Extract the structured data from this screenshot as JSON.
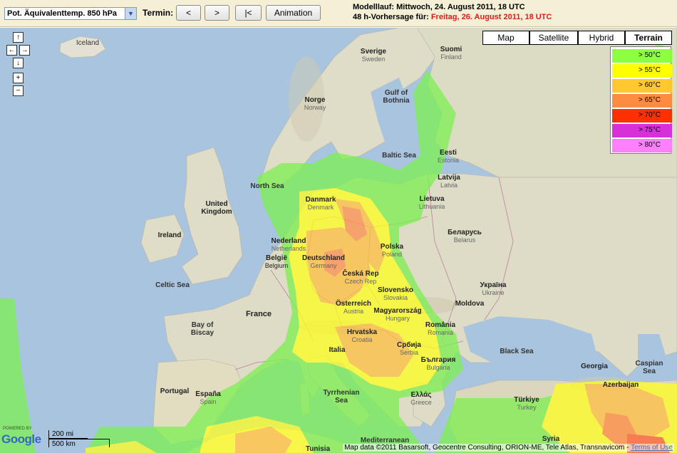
{
  "toolbar": {
    "parameter_selected": "Pot. Äquivalenttemp. 850 hPa",
    "termin_label": "Termin:",
    "btn_prev": "<",
    "btn_next": ">",
    "btn_first": "|<",
    "btn_animation": "Animation",
    "model_run": "Modelllauf: Mittwoch, 24. August 2011, 18 UTC",
    "forecast_prefix": "48 h-Vorhersage für: ",
    "forecast_date": "Freitag, 26. August 2011, 18 UTC"
  },
  "map_types": [
    {
      "label": "Map",
      "active": false
    },
    {
      "label": "Satellite",
      "active": false
    },
    {
      "label": "Hybrid",
      "active": false
    },
    {
      "label": "Terrain",
      "active": true
    }
  ],
  "nav": {
    "up": "↑",
    "left": "←",
    "right": "→",
    "down": "↓",
    "zoom_in": "+",
    "zoom_out": "−"
  },
  "legend": [
    {
      "label": "> 50°C",
      "color": "#8cff40"
    },
    {
      "label": "> 55°C",
      "color": "#ffff00"
    },
    {
      "label": "> 60°C",
      "color": "#ffc830"
    },
    {
      "label": "> 65°C",
      "color": "#ff8c40"
    },
    {
      "label": "> 70°C",
      "color": "#ff3000"
    },
    {
      "label": "> 75°C",
      "color": "#d830d8"
    },
    {
      "label": "> 80°C",
      "color": "#ff80ff"
    }
  ],
  "labels": {
    "iceland": "Iceland",
    "sverige": "Sverige",
    "sweden": "Sweden",
    "suomi": "Suomi",
    "finland": "Finland",
    "norge": "Norge",
    "norway": "Norway",
    "gulf": "Gulf of",
    "bothnia": "Bothnia",
    "eesti": "Eesti",
    "estonia": "Estonia",
    "baltic": "Baltic Sea",
    "latvija": "Latvija",
    "latvia": "Latvia",
    "lietuva": "Lietuva",
    "lithuania": "Lithuania",
    "north_sea": "North Sea",
    "uk1": "United",
    "uk2": "Kingdom",
    "danmark": "Danmark",
    "denmark": "Denmark",
    "belarus_l": "Беларусь",
    "belarus": "Belarus",
    "ireland": "Ireland",
    "nederland": "Nederland",
    "netherlands": "Netherlands",
    "belgie": "België",
    "belgium": "Belgium",
    "deutschland": "Deutschland",
    "germany": "Germany",
    "polska": "Polska",
    "poland": "Poland",
    "cesko": "Česká Rep",
    "czech": "Czech Rep",
    "ukraina": "Україна",
    "ukraine": "Ukraine",
    "celtic": "Celtic Sea",
    "slovensko": "Slovensko",
    "slovakia": "Slovakia",
    "france": "France",
    "osterreich": "Österreich",
    "austria": "Austria",
    "magyar": "Magyarország",
    "hungary": "Hungary",
    "moldova": "Moldova",
    "biscay1": "Bay of",
    "biscay2": "Biscay",
    "hrvatska": "Hrvatska",
    "croatia": "Croatia",
    "romania_l": "România",
    "romania": "Romania",
    "srbija": "Србија",
    "serbia": "Serbia",
    "black_sea": "Black Sea",
    "italia": "Italia",
    "bulgaria_l": "България",
    "bulgaria": "Bulgaria",
    "portugal": "Portugal",
    "espana": "España",
    "spain": "Spain",
    "tyrrhenian1": "Tyrrhenian",
    "tyrrhenian2": "Sea",
    "ellas": "Ελλάς",
    "greece": "Greece",
    "turkiye": "Türkiye",
    "turkey": "Turkey",
    "georgia": "Georgia",
    "azerbaijan": "Azerbaijan",
    "caspian1": "Caspian",
    "caspian2": "Sea",
    "syria": "Syria",
    "tunisia": "Tunisia",
    "mediterranean": "Mediterranean"
  },
  "scale": {
    "miles": "200 mi",
    "km": "500 km"
  },
  "powered_by": "POWERED BY",
  "logo": "Google",
  "attribution": "Map data ©2011 Basarsoft, Geocentre Consulting, ORION-ME, Tele Atlas, Transnavicom - ",
  "terms": "Terms of Use"
}
